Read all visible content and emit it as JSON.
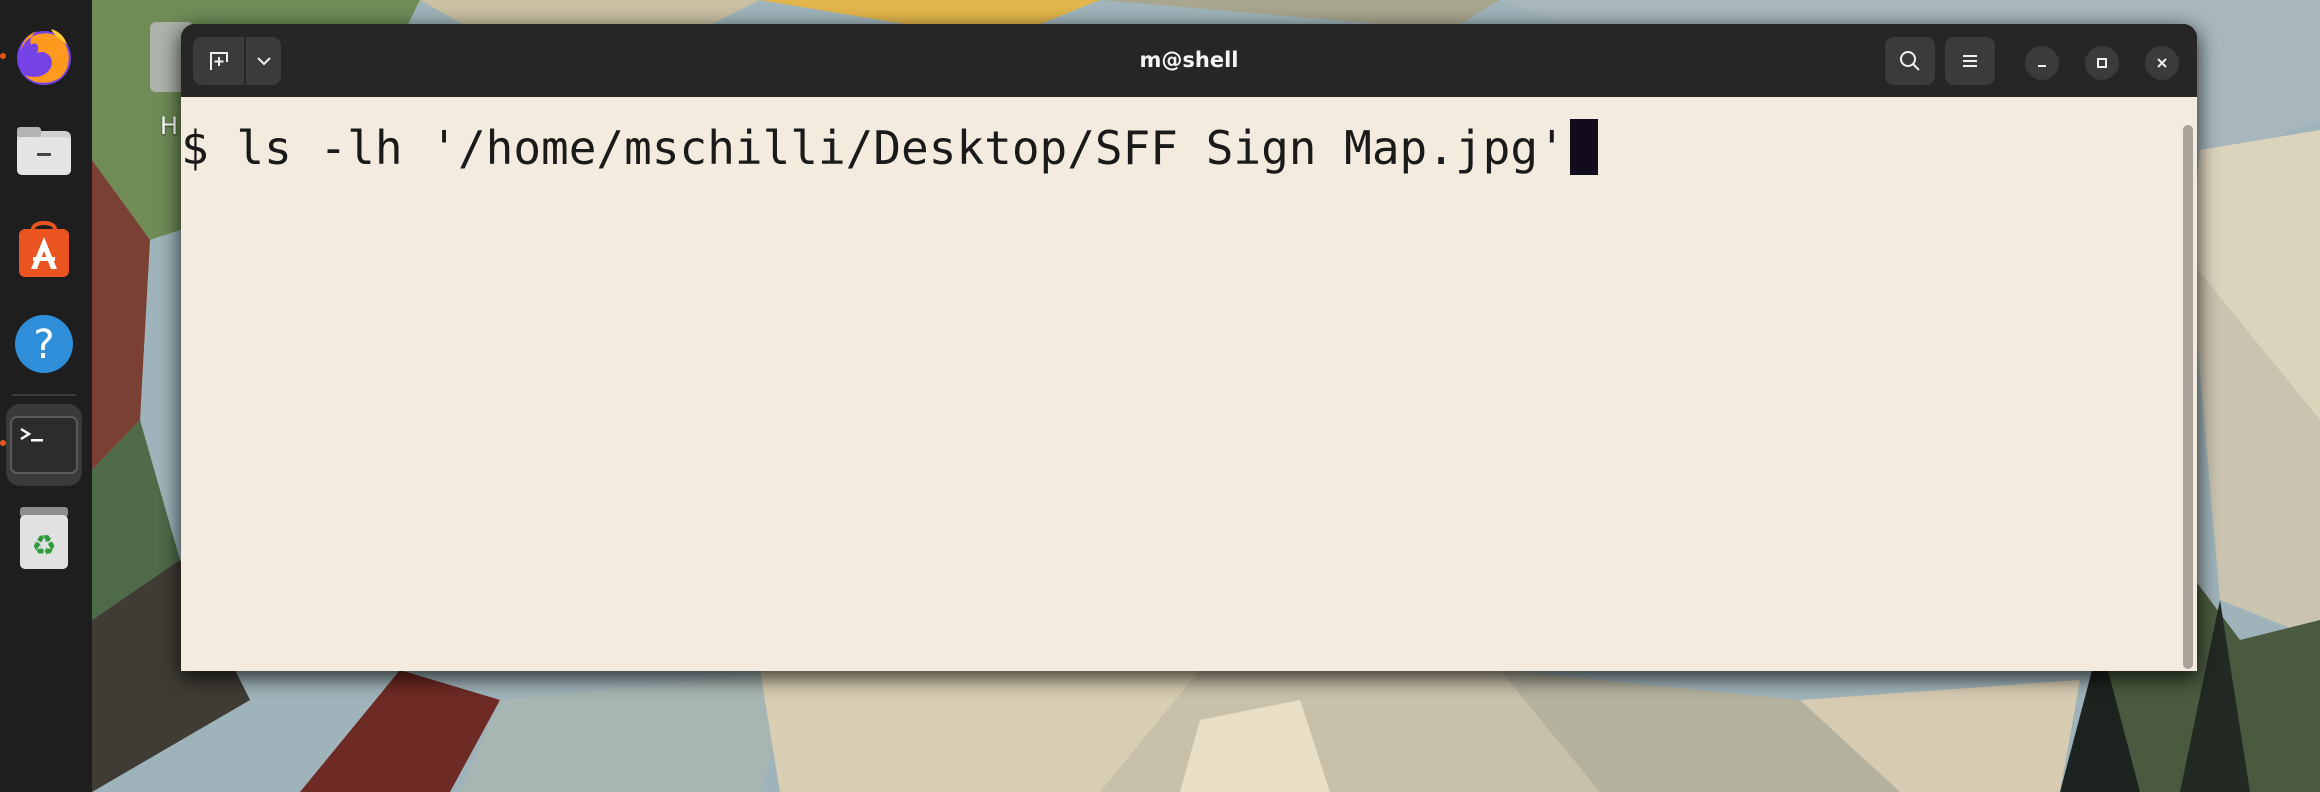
{
  "window": {
    "title": "m@shell"
  },
  "terminal": {
    "prompt": "$",
    "command": " ls -lh '/home/mschilli/Desktop/SFF Sign Map.jpg'"
  },
  "desktop": {
    "home_label_partial": "H"
  },
  "dock": {
    "items": [
      {
        "name": "firefox",
        "icon": "firefox-icon",
        "running": true
      },
      {
        "name": "files",
        "icon": "files-icon",
        "running": false
      },
      {
        "name": "app-center",
        "icon": "app-center-icon",
        "running": false
      },
      {
        "name": "help",
        "icon": "help-icon",
        "running": false
      },
      {
        "name": "terminal",
        "icon": "terminal-icon",
        "running": true,
        "active": true
      },
      {
        "name": "trash",
        "icon": "trash-icon",
        "running": false
      }
    ]
  },
  "titlebar": {
    "new_tab_icon": "new-tab-icon",
    "tab_menu_icon": "chevron-down-icon",
    "search_icon": "search-icon",
    "menu_icon": "hamburger-menu-icon",
    "minimize_icon": "minimize-icon",
    "maximize_icon": "maximize-icon",
    "close_icon": "close-icon"
  },
  "colors": {
    "terminal_bg": "#f3ebdd",
    "titlebar_bg": "#262626",
    "accent": "#e95420",
    "cursor": "#100c1c"
  }
}
